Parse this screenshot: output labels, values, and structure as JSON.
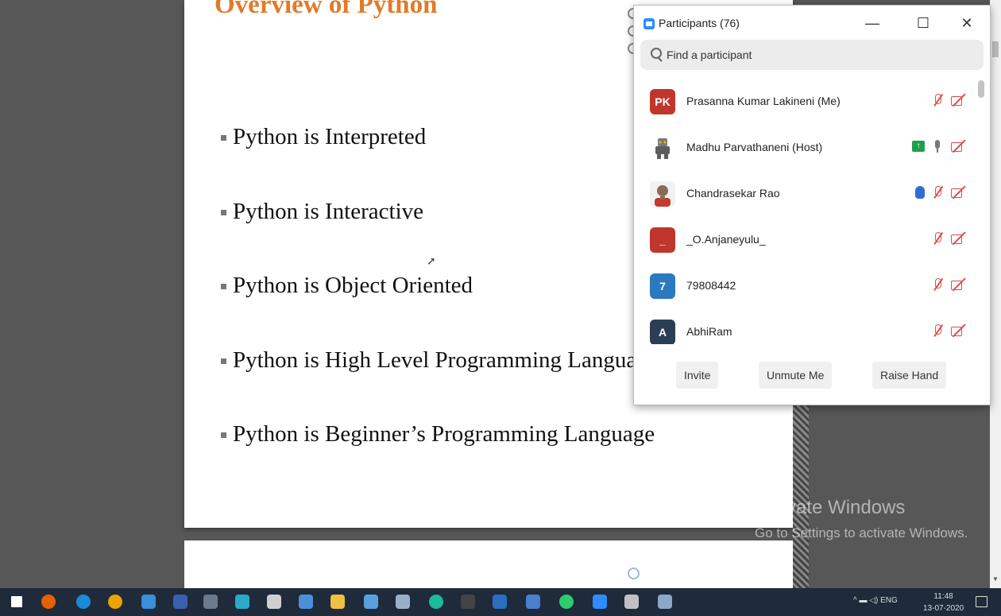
{
  "slide": {
    "title": "Overview of Python",
    "bullets": [
      "Python is Interpreted",
      "Python is Interactive",
      "Python is Object Oriented",
      "Python is High Level Programming Language",
      "Python is Beginner’s Programming Language"
    ]
  },
  "watermark": {
    "line1": "Activate Windows",
    "line2": "Go to Settings to activate Windows."
  },
  "participants_panel": {
    "title": "Participants (76)",
    "search_placeholder": "Find a participant",
    "participants": [
      {
        "name": "Prasanna Kumar Lakineni (Me)",
        "initials": "PK",
        "avatar_color": "#c0362c",
        "mic": "muted",
        "video": "off"
      },
      {
        "name": "Madhu Parvathaneni (Host)",
        "initials": "",
        "avatar_color": "#ffffff",
        "mic": "on",
        "video": "off",
        "sharing": true
      },
      {
        "name": "Chandrasekar Rao",
        "initials": "",
        "avatar_color": "#8a6b55",
        "mic": "muted",
        "video": "off",
        "hand_raised": true
      },
      {
        "name": "_O.Anjaneyulu_",
        "initials": "_",
        "avatar_color": "#c0362c",
        "mic": "muted",
        "video": "off"
      },
      {
        "name": "79808442",
        "initials": "7",
        "avatar_color": "#2a7abf",
        "mic": "muted",
        "video": "off"
      },
      {
        "name": "AbhiRam",
        "initials": "A",
        "avatar_color": "#2b3e55",
        "mic": "muted",
        "video": "off"
      }
    ],
    "buttons": {
      "invite": "Invite",
      "unmute": "Unmute Me",
      "raise_hand": "Raise Hand"
    }
  },
  "taskbar": {
    "language": "ENG",
    "time": "11:48",
    "date": "13-07-2020"
  }
}
